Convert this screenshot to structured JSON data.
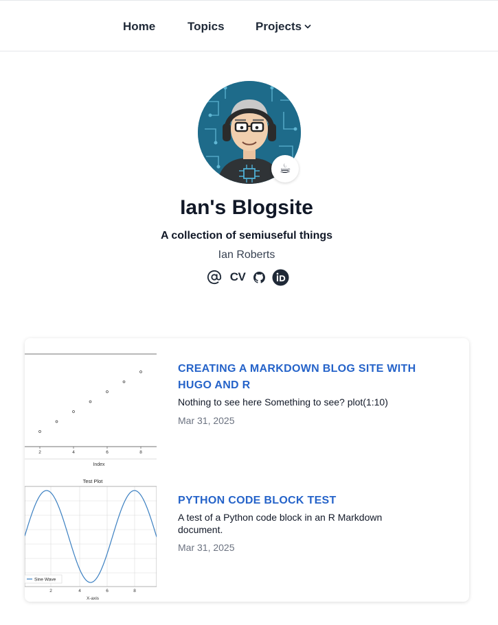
{
  "nav": {
    "home": "Home",
    "topics": "Topics",
    "projects": "Projects"
  },
  "profile": {
    "badge_emoji": "☕",
    "title": "Ian's Blogsite",
    "subtitle": "A collection of semiuseful things",
    "author": "Ian Roberts",
    "socials": [
      {
        "icon": "at-sign-icon"
      },
      {
        "label": "CV",
        "icon": "cv-icon"
      },
      {
        "icon": "github-icon"
      },
      {
        "icon": "orcid-icon"
      }
    ]
  },
  "posts": [
    {
      "title": "CREATING A MARKDOWN BLOG SITE WITH HUGO AND R",
      "summary": "Nothing to see here Something to see? plot(1:10)",
      "date": "Mar 31, 2025",
      "thumbnail": {
        "type": "scatter",
        "xlabel": "Index",
        "x_ticks": [
          "2",
          "4",
          "6",
          "8"
        ]
      }
    },
    {
      "title": "PYTHON CODE BLOCK TEST",
      "summary": "A test of a Python code block in an R Markdown document.",
      "date": "Mar 31, 2025",
      "thumbnail": {
        "type": "line",
        "title": "Test Plot",
        "xlabel": "X-axis",
        "legend": "Sine Wave",
        "x_ticks": [
          "2",
          "4",
          "6",
          "8"
        ]
      }
    }
  ],
  "colors": {
    "link": "#2563c9",
    "avatar_bg": "#1e6b8a",
    "sine": "#3a7fc1"
  }
}
